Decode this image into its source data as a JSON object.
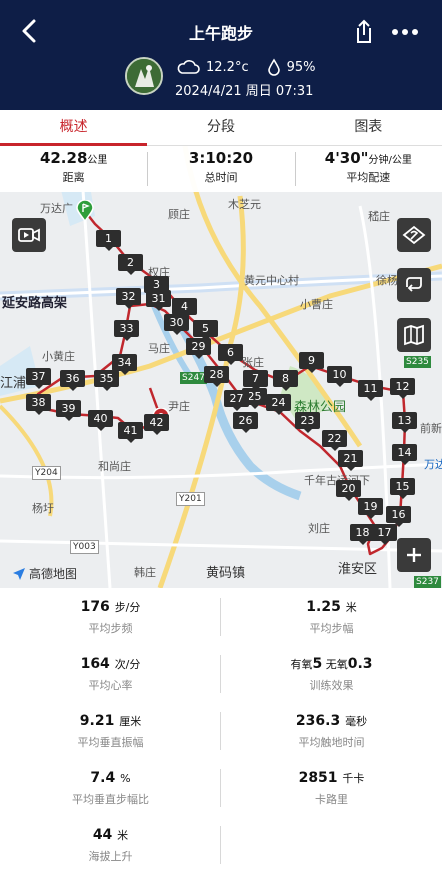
{
  "header": {
    "title": "上午跑步",
    "temperature": "12.2°c",
    "humidity": "95%",
    "datetime": "2024/4/21 周日 07:31",
    "bg_color": "#0e1e47"
  },
  "tabs": [
    "概述",
    "分段",
    "图表"
  ],
  "summary": [
    {
      "value": "42.28",
      "unit": "公里",
      "label": "距离"
    },
    {
      "value": "3:10:20",
      "unit": "",
      "label": "总时间"
    },
    {
      "value": "4'30\"",
      "unit": "分钟/公里",
      "label": "平均配速"
    }
  ],
  "map": {
    "places": [
      "万达广",
      "顾庄",
      "木芝元",
      "嵇庄",
      "黄元中心村",
      "徐杨",
      "小曹庄",
      "权庄",
      "延安路高架",
      "马庄",
      "张庄",
      "小黄庄",
      "江浦",
      "尹庄",
      "森林公园",
      "前新",
      "万达",
      "和尚庄",
      "千年古运河下",
      "杨圩",
      "刘庄",
      "韩庄",
      "黄码镇",
      "淮安区"
    ],
    "roads": [
      "S235",
      "S247",
      "Y204",
      "Y201",
      "Y003",
      "S237"
    ],
    "km_markers": [
      "1",
      "2",
      "3",
      "4",
      "5",
      "6",
      "7",
      "8",
      "9",
      "10",
      "11",
      "12",
      "13",
      "14",
      "15",
      "16",
      "17",
      "18",
      "19",
      "20",
      "21",
      "22",
      "23",
      "24",
      "25",
      "26",
      "27",
      "28",
      "29",
      "30",
      "31",
      "32",
      "33",
      "34",
      "35",
      "36",
      "37",
      "38",
      "39",
      "40",
      "41",
      "42"
    ],
    "provider": "高德地图",
    "route_color": "#c0272d"
  },
  "stats": [
    {
      "value": "176",
      "unit": "步/分",
      "label": "平均步频"
    },
    {
      "value": "1.25",
      "unit": "米",
      "label": "平均步幅"
    },
    {
      "value": "164",
      "unit": "次/分",
      "label": "平均心率"
    },
    {
      "value_prefix": "有氧",
      "value": "5",
      "value_mid": " 无氧",
      "value2": "0.3",
      "label": "训练效果"
    },
    {
      "value": "9.21",
      "unit": "厘米",
      "label": "平均垂直振幅"
    },
    {
      "value": "236.3",
      "unit": "毫秒",
      "label": "平均触地时间"
    },
    {
      "value": "7.4",
      "unit": "%",
      "label": "平均垂直步幅比"
    },
    {
      "value": "2851",
      "unit": "千卡",
      "label": "卡路里"
    },
    {
      "value": "44",
      "unit": "米",
      "label": "海拔上升"
    }
  ]
}
